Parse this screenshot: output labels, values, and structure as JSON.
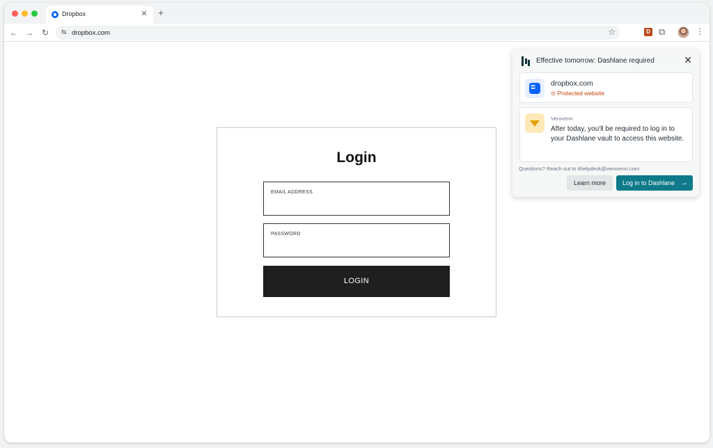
{
  "browser": {
    "tab_title": "Dropbox",
    "tab_close": "✕",
    "new_tab": "+",
    "url": "dropbox.com",
    "nav": {
      "back": "←",
      "forward": "→",
      "reload": "↻"
    },
    "extension_letter": "D"
  },
  "login": {
    "title": "Login",
    "email_label": "EMAIL ADDRESS",
    "password_label": "PASSWORD",
    "button_label": "LOGIN"
  },
  "dashlane": {
    "title": "Effective tomorrow: Dashlane required",
    "site": {
      "name": "dropbox.com",
      "status": "Protected website"
    },
    "message": {
      "org": "Verovenn",
      "text": "After today, you'll be required to log in to your Dashlane vault to access this website."
    },
    "questions": "Questions? Reach out to ithelpdesk@verovenn.com",
    "learn_more": "Learn more",
    "login_button": "Log in to Dashlane"
  },
  "colors": {
    "accent": "#0e7a8a",
    "warning": "#c2410c",
    "dropbox_blue": "#0061fe"
  }
}
